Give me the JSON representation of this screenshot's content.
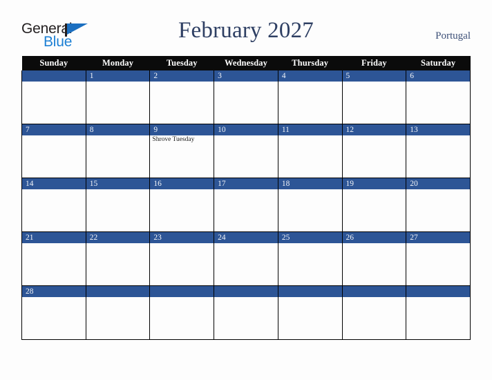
{
  "brand": {
    "word_one": "General",
    "word_two": "Blue",
    "triangle_icon": "triangle-icon",
    "accent_dark": "#231f20",
    "accent_blue": "#1b7fd4",
    "triangle_blue": "#1b6fc0"
  },
  "header": {
    "title": "February 2027",
    "locale": "Portugal",
    "title_color": "#2e3f63",
    "locale_color": "#3c4f77"
  },
  "calendar": {
    "header_bg": "#0b0b0b",
    "daynum_bg": "#2d5596",
    "cell_bg": "#fdfdfd",
    "weekdays": [
      "Sunday",
      "Monday",
      "Tuesday",
      "Wednesday",
      "Thursday",
      "Friday",
      "Saturday"
    ],
    "weeks": [
      [
        {
          "day": "",
          "events": []
        },
        {
          "day": "1",
          "events": []
        },
        {
          "day": "2",
          "events": []
        },
        {
          "day": "3",
          "events": []
        },
        {
          "day": "4",
          "events": []
        },
        {
          "day": "5",
          "events": []
        },
        {
          "day": "6",
          "events": []
        }
      ],
      [
        {
          "day": "7",
          "events": []
        },
        {
          "day": "8",
          "events": []
        },
        {
          "day": "9",
          "events": [
            "Shrove Tuesday"
          ]
        },
        {
          "day": "10",
          "events": []
        },
        {
          "day": "11",
          "events": []
        },
        {
          "day": "12",
          "events": []
        },
        {
          "day": "13",
          "events": []
        }
      ],
      [
        {
          "day": "14",
          "events": []
        },
        {
          "day": "15",
          "events": []
        },
        {
          "day": "16",
          "events": []
        },
        {
          "day": "17",
          "events": []
        },
        {
          "day": "18",
          "events": []
        },
        {
          "day": "19",
          "events": []
        },
        {
          "day": "20",
          "events": []
        }
      ],
      [
        {
          "day": "21",
          "events": []
        },
        {
          "day": "22",
          "events": []
        },
        {
          "day": "23",
          "events": []
        },
        {
          "day": "24",
          "events": []
        },
        {
          "day": "25",
          "events": []
        },
        {
          "day": "26",
          "events": []
        },
        {
          "day": "27",
          "events": []
        }
      ],
      [
        {
          "day": "28",
          "events": []
        },
        {
          "day": "",
          "events": []
        },
        {
          "day": "",
          "events": []
        },
        {
          "day": "",
          "events": []
        },
        {
          "day": "",
          "events": []
        },
        {
          "day": "",
          "events": []
        },
        {
          "day": "",
          "events": []
        }
      ]
    ]
  }
}
